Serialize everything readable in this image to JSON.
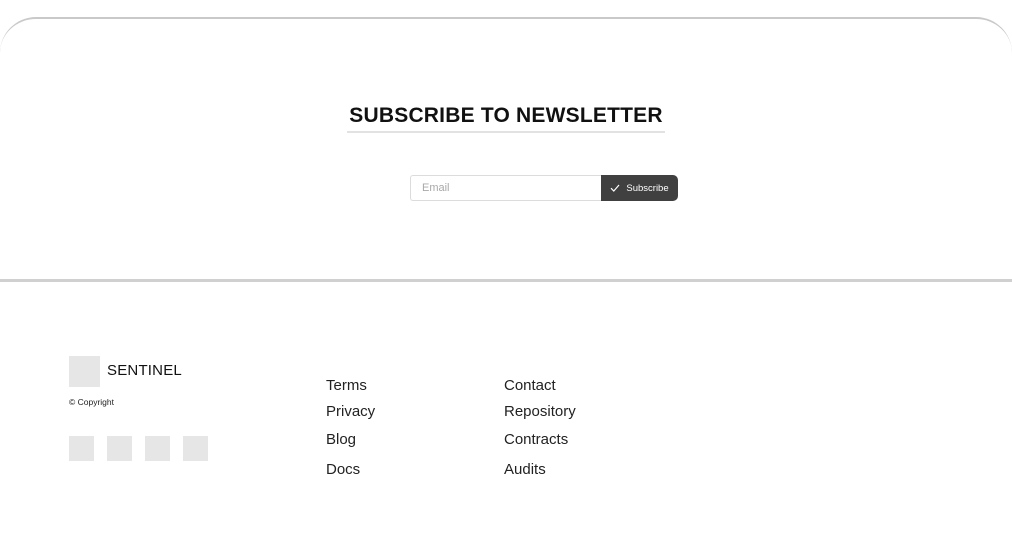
{
  "newsletter": {
    "title": "SUBSCRIBE TO NEWSLETTER",
    "email_placeholder": "Email",
    "email_value": "",
    "subscribe_label": "Subscribe",
    "subscribe_icon": "check-icon",
    "button_color": "#404040"
  },
  "footer": {
    "brand": {
      "name": "SENTINEL",
      "logo_icon": "image-placeholder-icon",
      "copyright": "© Copyright"
    },
    "social_icons": [
      "social-icon-1",
      "social-icon-2",
      "social-icon-3",
      "social-icon-4"
    ],
    "links_col1": [
      "Terms",
      "Privacy",
      "Blog",
      "Docs"
    ],
    "links_col2": [
      "Contact",
      "Repository",
      "Contracts",
      "Audits"
    ]
  }
}
